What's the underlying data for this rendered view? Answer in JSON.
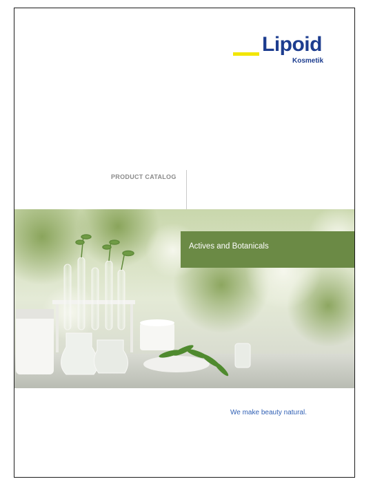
{
  "brand": {
    "name": "Lipoid",
    "subname": "Kosmetik",
    "colors": {
      "primary": "#1d3d8f",
      "accent": "#f2e600",
      "green": "#6b8a45",
      "tagline": "#2f5fb4"
    }
  },
  "cover": {
    "label": "PRODUCT CATALOG",
    "title": "Actives and Botanicals",
    "tagline": "We make beauty natural."
  },
  "hero": {
    "subject": "lab-glassware-with-plants-photo"
  }
}
